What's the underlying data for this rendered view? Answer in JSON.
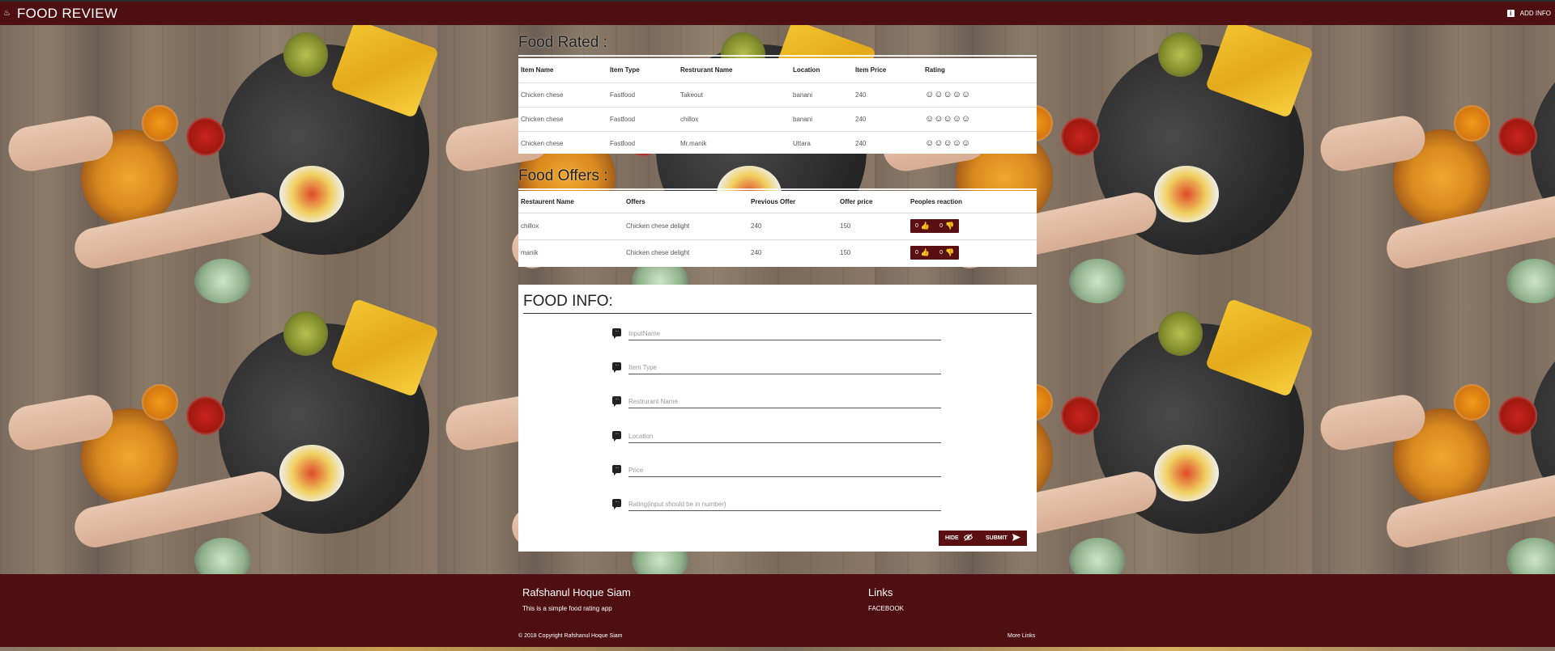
{
  "app": {
    "brand": "FOOD REVIEW",
    "add_info_label": "ADD INFO",
    "accent_color": "#4d0f10",
    "icons": {
      "logo": "food-logo-icon",
      "add_info": "info-icon"
    }
  },
  "food_rated": {
    "title": "Food Rated :",
    "columns": [
      "Item Name",
      "Item Type",
      "Restrurant Name",
      "Location",
      "Item Price",
      "Rating"
    ],
    "rows": [
      {
        "item": "Chicken chese",
        "type": "Fastfood",
        "restaurant": "Takeout",
        "location": "banani",
        "price": "240",
        "rating": "☺☺☺☺☺"
      },
      {
        "item": "Chicken chese",
        "type": "Fastfood",
        "restaurant": "chillox",
        "location": "banani",
        "price": "240",
        "rating": "☺☺☺☺☺"
      },
      {
        "item": "Chicken chese",
        "type": "Fastfood",
        "restaurant": "Mr.manik",
        "location": "Uttara",
        "price": "240",
        "rating": "☺☺☺☺☺"
      }
    ]
  },
  "food_offers": {
    "title": "Food Offers :",
    "columns": [
      "Restaurent Name",
      "Offers",
      "Previous Offer",
      "Offer price",
      "Peoples reaction"
    ],
    "rows": [
      {
        "restaurant": "chillox",
        "offer": "Chicken chese delight",
        "previous": "240",
        "price": "150",
        "likes": "0",
        "dislikes": "0"
      },
      {
        "restaurant": "manik",
        "offer": "Chicken chese delight",
        "previous": "240",
        "price": "150",
        "likes": "0",
        "dislikes": "0"
      }
    ]
  },
  "food_info": {
    "title": "FOOD INFO:",
    "fields": [
      {
        "placeholder": "InputName"
      },
      {
        "placeholder": "Item Type"
      },
      {
        "placeholder": "Restrurant Name"
      },
      {
        "placeholder": "Location"
      },
      {
        "placeholder": "Price"
      },
      {
        "placeholder": "Rating(input should be in number)"
      }
    ],
    "hide_label": "HIDE",
    "submit_label": "SUBMIT"
  },
  "footer": {
    "name": "Rafshanul Hoque Siam",
    "description": "This is a simple food rating app",
    "links_heading": "Links",
    "facebook_label": "FACEBOOK",
    "copyright": "© 2018 Copyright Rafshanul Hoque Siam",
    "more_links": "More Links"
  }
}
